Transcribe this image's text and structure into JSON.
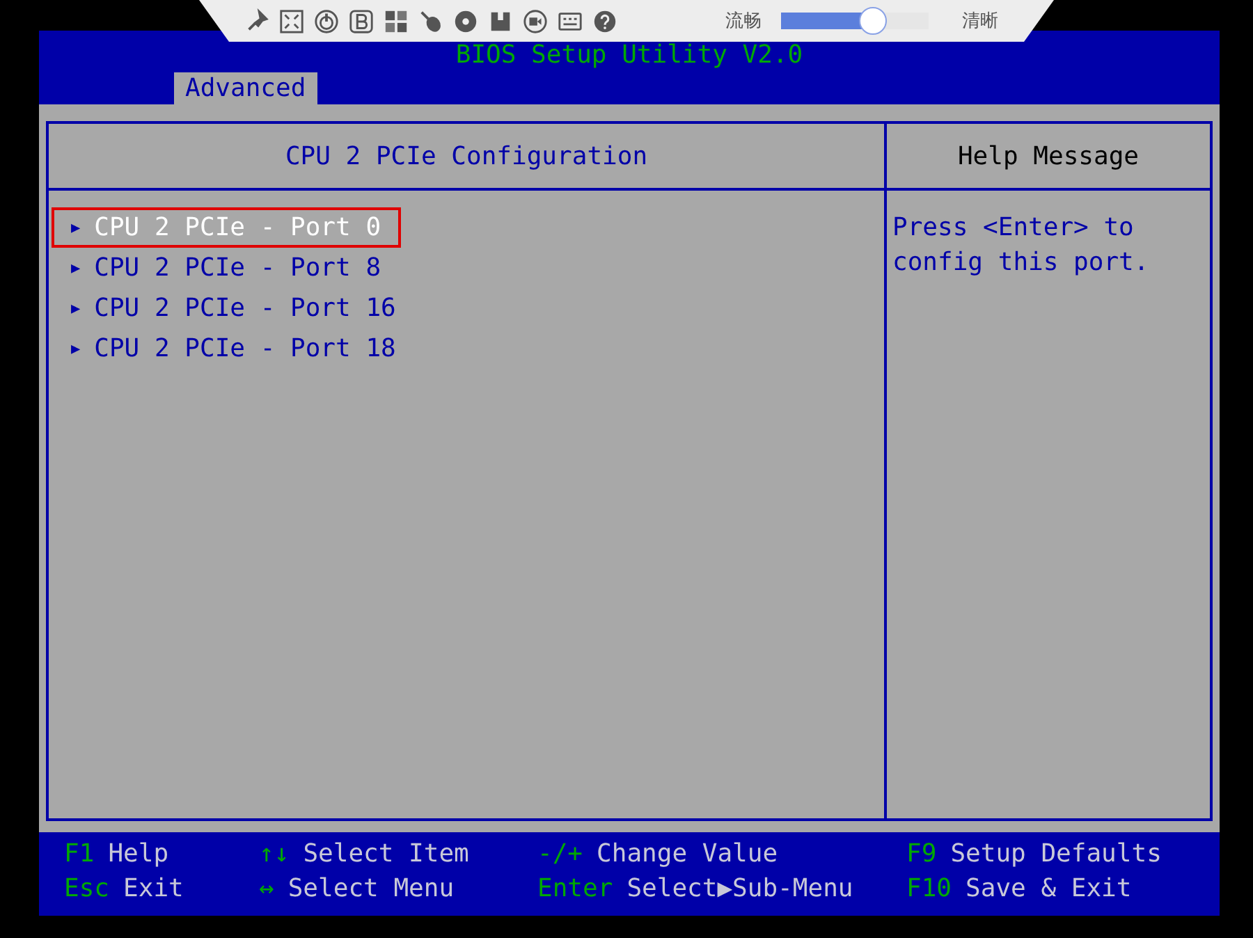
{
  "toolbar": {
    "quality_low": "流畅",
    "quality_high": "清晰",
    "quality_slider": {
      "level": 0.62
    }
  },
  "title": "BIOS Setup Utility V2.0",
  "tabs": [
    {
      "label": "Advanced",
      "selected": true
    }
  ],
  "panel": {
    "heading": "CPU 2 PCIe Configuration",
    "items": [
      {
        "arrow": "▶",
        "label": "CPU 2 PCIe - Port 0",
        "selected": true
      },
      {
        "arrow": "▶",
        "label": "CPU 2 PCIe - Port 8",
        "selected": false
      },
      {
        "arrow": "▶",
        "label": "CPU 2 PCIe - Port 16",
        "selected": false
      },
      {
        "arrow": "▶",
        "label": "CPU 2 PCIe - Port 18",
        "selected": false
      }
    ]
  },
  "help": {
    "heading": "Help Message",
    "text": "Press <Enter> to config this port."
  },
  "footer": [
    {
      "key": "F1",
      "action": "Help"
    },
    {
      "key": "↑↓",
      "action": "Select Item"
    },
    {
      "key": "-/+",
      "action": "Change Value"
    },
    {
      "key": "F9",
      "action": "Setup Defaults"
    },
    {
      "key": "Esc",
      "action": "Exit"
    },
    {
      "key": "↔",
      "action": "Select Menu"
    },
    {
      "key": "Enter",
      "action": "Select▶Sub-Menu"
    },
    {
      "key": "F10",
      "action": "Save & Exit"
    }
  ]
}
